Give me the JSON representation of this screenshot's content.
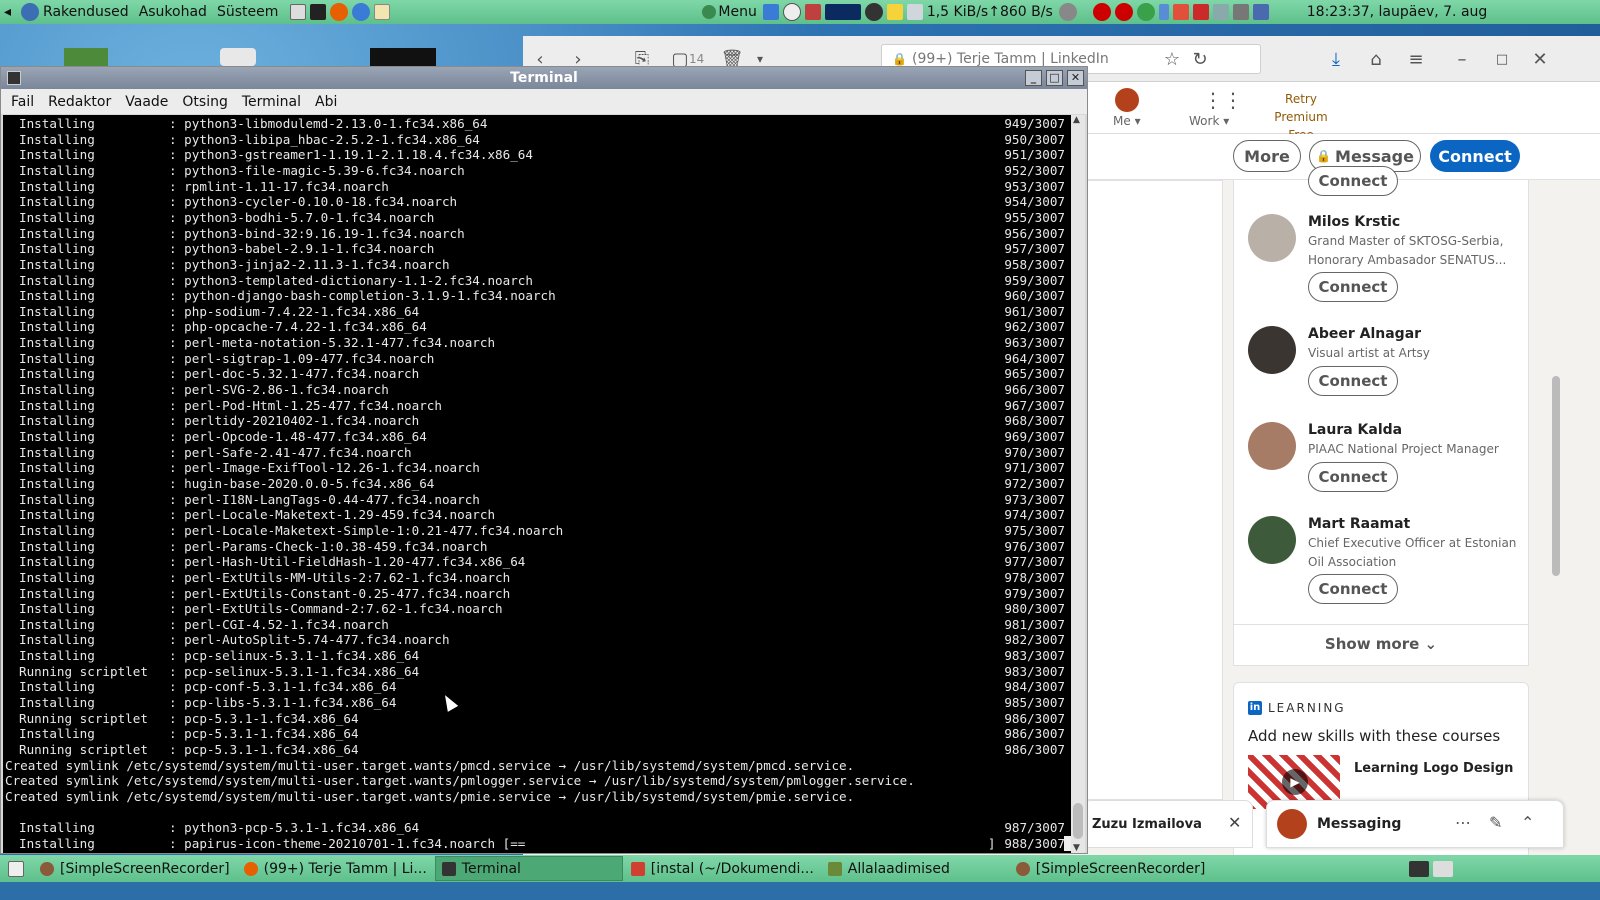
{
  "top_panel": {
    "menus": [
      "Rakendused",
      "Asukohad",
      "Süsteem"
    ],
    "menu_label": "Menu",
    "net_down": "1,5 KiB/s",
    "net_up": "860 B/s",
    "clock": "18:23:37, laupäev,  7. aug"
  },
  "firefox": {
    "url": "(99+) Terje Tamm | LinkedIn",
    "badge": "14"
  },
  "linkedin": {
    "nav": {
      "me": "Me",
      "work": "Work",
      "premium_1": "Retry Premium",
      "premium_2": "Free"
    },
    "actions": {
      "more": "More",
      "message": "Message",
      "connect": "Connect"
    },
    "people": [
      {
        "name": "Milos Krstic",
        "title": "Grand Master of SKTOSG-Serbia, Honorary Ambasador SENATUS...",
        "button": "Connect",
        "avatar_color": "#b9b1a8"
      },
      {
        "name": "Abeer Alnagar",
        "title": "Visual artist at Artsy",
        "button": "Connect",
        "avatar_color": "#3a3530"
      },
      {
        "name": "Laura Kalda",
        "title": "PIAAC National Project Manager",
        "button": "Connect",
        "avatar_color": "#a67c66"
      },
      {
        "name": "Mart Raamat",
        "title": "Chief Executive Officer at Estonian Oil Association",
        "button": "Connect",
        "avatar_color": "#3d5a3a"
      }
    ],
    "top_partial_button": "Connect",
    "show_more": "Show more",
    "learning": {
      "logo": "in",
      "label": "LEARNING",
      "heading": "Add new skills with these courses",
      "course": "Learning Logo Design"
    },
    "chat_name": "Zuzu Izmailova",
    "messaging": "Messaging"
  },
  "terminal": {
    "title": "Terminal",
    "menu": [
      "Fail",
      "Redaktor",
      "Vaade",
      "Otsing",
      "Terminal",
      "Abi"
    ],
    "lines": [
      {
        "action": "Installing",
        "pkg": ": python3-libmodulemd-2.13.0-1.fc34.x86_64",
        "count": "949/3007"
      },
      {
        "action": "Installing",
        "pkg": ": python3-libipa_hbac-2.5.2-1.fc34.x86_64",
        "count": "950/3007"
      },
      {
        "action": "Installing",
        "pkg": ": python3-gstreamer1-1.19.1-2.1.18.4.fc34.x86_64",
        "count": "951/3007"
      },
      {
        "action": "Installing",
        "pkg": ": python3-file-magic-5.39-6.fc34.noarch",
        "count": "952/3007"
      },
      {
        "action": "Installing",
        "pkg": ": rpmlint-1.11-17.fc34.noarch",
        "count": "953/3007"
      },
      {
        "action": "Installing",
        "pkg": ": python3-cycler-0.10.0-18.fc34.noarch",
        "count": "954/3007"
      },
      {
        "action": "Installing",
        "pkg": ": python3-bodhi-5.7.0-1.fc34.noarch",
        "count": "955/3007"
      },
      {
        "action": "Installing",
        "pkg": ": python3-bind-32:9.16.19-1.fc34.noarch",
        "count": "956/3007"
      },
      {
        "action": "Installing",
        "pkg": ": python3-babel-2.9.1-1.fc34.noarch",
        "count": "957/3007"
      },
      {
        "action": "Installing",
        "pkg": ": python3-jinja2-2.11.3-1.fc34.noarch",
        "count": "958/3007"
      },
      {
        "action": "Installing",
        "pkg": ": python3-templated-dictionary-1.1-2.fc34.noarch",
        "count": "959/3007"
      },
      {
        "action": "Installing",
        "pkg": ": python-django-bash-completion-3.1.9-1.fc34.noarch",
        "count": "960/3007"
      },
      {
        "action": "Installing",
        "pkg": ": php-sodium-7.4.22-1.fc34.x86_64",
        "count": "961/3007"
      },
      {
        "action": "Installing",
        "pkg": ": php-opcache-7.4.22-1.fc34.x86_64",
        "count": "962/3007"
      },
      {
        "action": "Installing",
        "pkg": ": perl-meta-notation-5.32.1-477.fc34.noarch",
        "count": "963/3007"
      },
      {
        "action": "Installing",
        "pkg": ": perl-sigtrap-1.09-477.fc34.noarch",
        "count": "964/3007"
      },
      {
        "action": "Installing",
        "pkg": ": perl-doc-5.32.1-477.fc34.noarch",
        "count": "965/3007"
      },
      {
        "action": "Installing",
        "pkg": ": perl-SVG-2.86-1.fc34.noarch",
        "count": "966/3007"
      },
      {
        "action": "Installing",
        "pkg": ": perl-Pod-Html-1.25-477.fc34.noarch",
        "count": "967/3007"
      },
      {
        "action": "Installing",
        "pkg": ": perltidy-20210402-1.fc34.noarch",
        "count": "968/3007"
      },
      {
        "action": "Installing",
        "pkg": ": perl-Opcode-1.48-477.fc34.x86_64",
        "count": "969/3007"
      },
      {
        "action": "Installing",
        "pkg": ": perl-Safe-2.41-477.fc34.noarch",
        "count": "970/3007"
      },
      {
        "action": "Installing",
        "pkg": ": perl-Image-ExifTool-12.26-1.fc34.noarch",
        "count": "971/3007"
      },
      {
        "action": "Installing",
        "pkg": ": hugin-base-2020.0.0-5.fc34.x86_64",
        "count": "972/3007"
      },
      {
        "action": "Installing",
        "pkg": ": perl-I18N-LangTags-0.44-477.fc34.noarch",
        "count": "973/3007"
      },
      {
        "action": "Installing",
        "pkg": ": perl-Locale-Maketext-1.29-459.fc34.noarch",
        "count": "974/3007"
      },
      {
        "action": "Installing",
        "pkg": ": perl-Locale-Maketext-Simple-1:0.21-477.fc34.noarch",
        "count": "975/3007"
      },
      {
        "action": "Installing",
        "pkg": ": perl-Params-Check-1:0.38-459.fc34.noarch",
        "count": "976/3007"
      },
      {
        "action": "Installing",
        "pkg": ": perl-Hash-Util-FieldHash-1.20-477.fc34.x86_64",
        "count": "977/3007"
      },
      {
        "action": "Installing",
        "pkg": ": perl-ExtUtils-MM-Utils-2:7.62-1.fc34.noarch",
        "count": "978/3007"
      },
      {
        "action": "Installing",
        "pkg": ": perl-ExtUtils-Constant-0.25-477.fc34.noarch",
        "count": "979/3007"
      },
      {
        "action": "Installing",
        "pkg": ": perl-ExtUtils-Command-2:7.62-1.fc34.noarch",
        "count": "980/3007"
      },
      {
        "action": "Installing",
        "pkg": ": perl-CGI-4.52-1.fc34.noarch",
        "count": "981/3007"
      },
      {
        "action": "Installing",
        "pkg": ": perl-AutoSplit-5.74-477.fc34.noarch",
        "count": "982/3007"
      },
      {
        "action": "Installing",
        "pkg": ": pcp-selinux-5.3.1-1.fc34.x86_64",
        "count": "983/3007"
      },
      {
        "action": "Running scriptlet",
        "pkg": ": pcp-selinux-5.3.1-1.fc34.x86_64",
        "count": "983/3007"
      },
      {
        "action": "Installing",
        "pkg": ": pcp-conf-5.3.1-1.fc34.x86_64",
        "count": "984/3007"
      },
      {
        "action": "Installing",
        "pkg": ": pcp-libs-5.3.1-1.fc34.x86_64",
        "count": "985/3007"
      },
      {
        "action": "Running scriptlet",
        "pkg": ": pcp-5.3.1-1.fc34.x86_64",
        "count": "986/3007"
      },
      {
        "action": "Installing",
        "pkg": ": pcp-5.3.1-1.fc34.x86_64",
        "count": "986/3007"
      },
      {
        "action": "Running scriptlet",
        "pkg": ": pcp-5.3.1-1.fc34.x86_64",
        "count": "986/3007"
      },
      {
        "full": "Created symlink /etc/systemd/system/multi-user.target.wants/pmcd.service → /usr/lib/systemd/system/pmcd.service."
      },
      {
        "full": "Created symlink /etc/systemd/system/multi-user.target.wants/pmlogger.service → /usr/lib/systemd/system/pmlogger.service."
      },
      {
        "full": "Created symlink /etc/systemd/system/multi-user.target.wants/pmie.service → /usr/lib/systemd/system/pmie.service."
      },
      {
        "full": ""
      },
      {
        "action": "Installing",
        "pkg": ": python3-pcp-5.3.1-1.fc34.x86_64",
        "count": "987/3007"
      },
      {
        "action": "Installing",
        "pkg": ": papirus-icon-theme-20210701-1.fc34.noarch [==                                                             ]",
        "count": "988/3007"
      }
    ]
  },
  "taskbar": {
    "items": [
      {
        "label": "[SimpleScreenRecorder]",
        "icon_color": "#8a5a3a"
      },
      {
        "label": "(99+) Terje Tamm | Li...",
        "icon_color": "#e66000"
      },
      {
        "label": "Terminal",
        "icon_color": "#333333"
      },
      {
        "label": "[instal (~/Dokumendi...",
        "icon_color": "#d04030"
      },
      {
        "label": "Allalaadimised",
        "icon_color": "#6a8a3a"
      },
      {
        "label": "[SimpleScreenRecorder]",
        "icon_color": "#8a5a3a"
      }
    ]
  },
  "colors": {
    "panel": "#6ccb98",
    "linkedin_blue": "#0a66c2",
    "terminal_bg": "#000000"
  }
}
